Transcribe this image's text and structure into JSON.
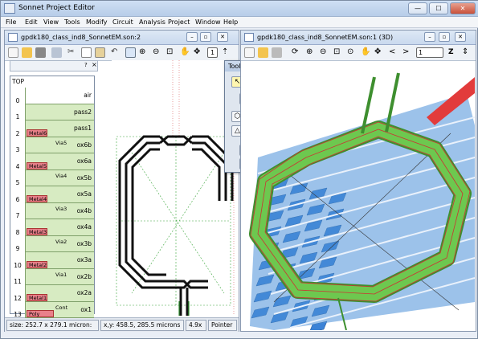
{
  "app": {
    "title": "Sonnet Project Editor",
    "minimize": "—",
    "maximize": "☐",
    "close": "✕"
  },
  "menu": [
    "File",
    "Edit",
    "View",
    "Tools",
    "Modify",
    "Circuit",
    "Analysis",
    "Project",
    "Window",
    "Help"
  ],
  "left_window": {
    "title": "gpdk180_class_ind8_SonnetEM.son:2",
    "page_number": "1",
    "stack": {
      "top_label": "TOP",
      "levels": [
        {
          "n": "0",
          "label": "air"
        },
        {
          "n": "1",
          "label": "pass2"
        },
        {
          "n": "2",
          "label": "pass1"
        },
        {
          "n": "3",
          "label": "ox6b"
        },
        {
          "n": "4",
          "label": "ox6a"
        },
        {
          "n": "5",
          "label": "ox5b"
        },
        {
          "n": "6",
          "label": "ox5a"
        },
        {
          "n": "7",
          "label": "ox4b"
        },
        {
          "n": "8",
          "label": "ox4a"
        },
        {
          "n": "9",
          "label": "ox3b"
        },
        {
          "n": "10",
          "label": "ox3a"
        },
        {
          "n": "11",
          "label": "ox2b"
        },
        {
          "n": "12",
          "label": "ox2a"
        },
        {
          "n": "13",
          "label": "ox1"
        }
      ],
      "metals": [
        "Metal6",
        "Metal5",
        "Metal4",
        "Metal3",
        "Metal2",
        "Metal1",
        "Poly"
      ],
      "vias": [
        "Via5",
        "Via4",
        "Via3",
        "Via2",
        "Via1",
        "Cont"
      ]
    },
    "status": {
      "size": "size: 252.7 x 279.1 micron:",
      "xy": "x,y: 458.5, 285.5 microns",
      "zoom": "4.9x",
      "mode": "Pointer"
    }
  },
  "right_window": {
    "title": "gpdk180_class_ind8_SonnetEM.son:1 (3D)",
    "page_field": "1",
    "z_label": "Z",
    "prev": "<",
    "next": ">"
  },
  "toolbox": {
    "title": "Toolbox",
    "close": "✕"
  },
  "colors": {
    "metal": "#e9808a",
    "via": "#f7c36a",
    "dielectric": "#cfe8b4",
    "trace_3d": "#5fbf4a",
    "plate_3d": "#3b82d6"
  }
}
